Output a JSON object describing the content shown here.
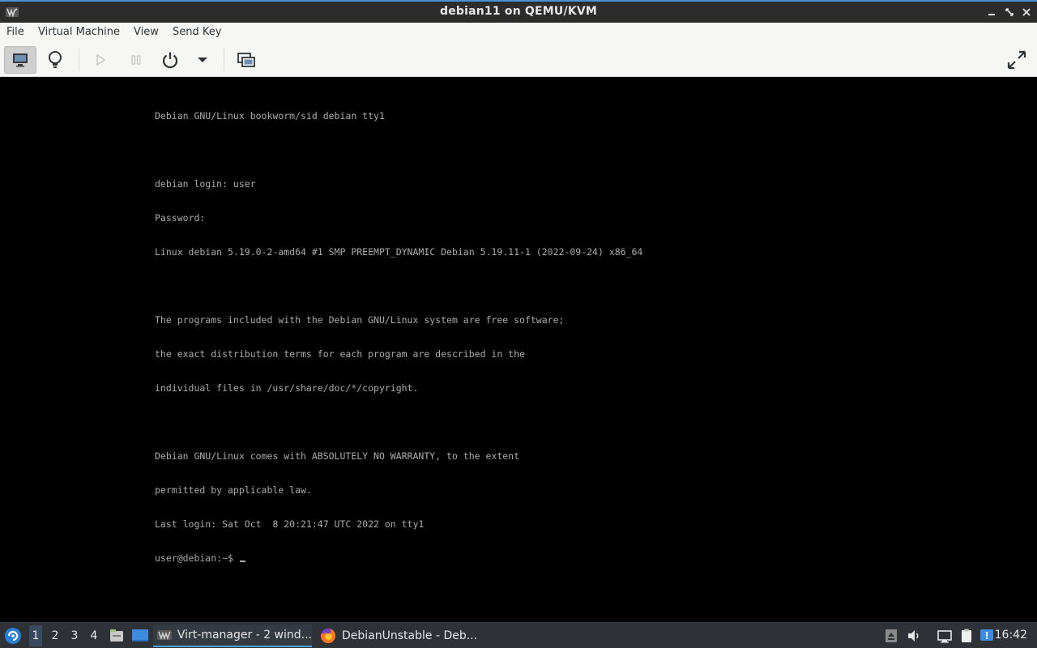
{
  "window": {
    "title": "debian11 on QEMU/KVM"
  },
  "menubar": {
    "items": [
      "File",
      "Virtual Machine",
      "View",
      "Send Key"
    ]
  },
  "toolbar": {
    "buttons": [
      "console",
      "details",
      "run",
      "pause",
      "shutdown",
      "shutdown-menu",
      "snapshots",
      "fullscreen"
    ]
  },
  "console": {
    "lines": [
      "Debian GNU/Linux bookworm/sid debian tty1",
      "",
      "debian login: user",
      "Password:",
      "Linux debian 5.19.0-2-amd64 #1 SMP PREEMPT_DYNAMIC Debian 5.19.11-1 (2022-09-24) x86_64",
      "",
      "The programs included with the Debian GNU/Linux system are free software;",
      "the exact distribution terms for each program are described in the",
      "individual files in /usr/share/doc/*/copyright.",
      "",
      "Debian GNU/Linux comes with ABSOLUTELY NO WARRANTY, to the extent",
      "permitted by applicable law.",
      "Last login: Sat Oct  8 20:21:47 UTC 2022 on tty1"
    ],
    "prompt": "user@debian:~$ "
  },
  "taskbar": {
    "workspaces": [
      "1",
      "2",
      "3",
      "4"
    ],
    "active_workspace": "1",
    "tasks": [
      {
        "label": "Virt-manager - 2 wind...",
        "icon": "virt-manager-icon"
      },
      {
        "label": "DebianUnstable - Deb...",
        "icon": "firefox-icon"
      }
    ],
    "clock": "16:42"
  },
  "colors": {
    "titlebar": "#2c2c2c",
    "accent": "#4a90d9",
    "console_text": "#aaaaaa",
    "taskbar": "#2e3237"
  }
}
